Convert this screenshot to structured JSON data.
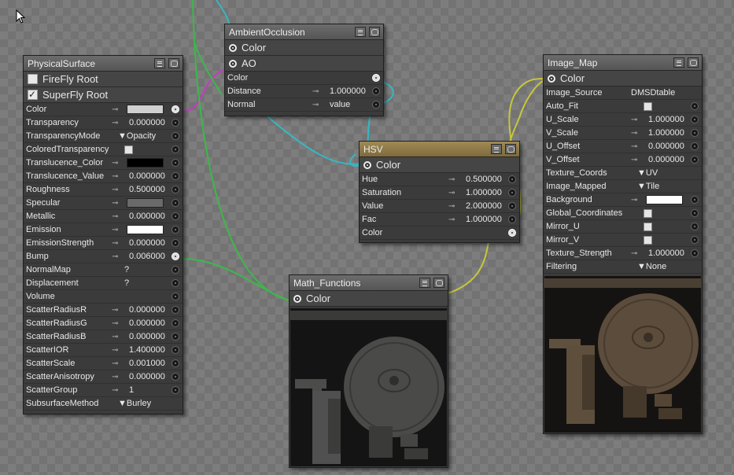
{
  "nodes": {
    "physical": {
      "title": "PhysicalSurface",
      "toggles": [
        {
          "label": "FireFly Root",
          "checked": false
        },
        {
          "label": "SuperFly Root",
          "checked": true
        }
      ],
      "rows": [
        {
          "label": "Color",
          "kind": "swatch",
          "color": "#cfcfcf",
          "out": true
        },
        {
          "label": "Transparency",
          "kind": "num",
          "value": "0.000000"
        },
        {
          "label": "TransparencyMode",
          "kind": "enum",
          "value": "▼Opacity"
        },
        {
          "label": "ColoredTransparency",
          "kind": "check"
        },
        {
          "label": "Translucence_Color",
          "kind": "swatch",
          "color": "#000000"
        },
        {
          "label": "Translucence_Value",
          "kind": "num",
          "value": "0.000000"
        },
        {
          "label": "Roughness",
          "kind": "num",
          "value": "0.500000"
        },
        {
          "label": "Specular",
          "kind": "swatch",
          "color": "#6a6a6a"
        },
        {
          "label": "Metallic",
          "kind": "num",
          "value": "0.000000"
        },
        {
          "label": "Emission",
          "kind": "swatch",
          "color": "#ffffff"
        },
        {
          "label": "EmissionStrength",
          "kind": "num",
          "value": "0.000000"
        },
        {
          "label": "Bump",
          "kind": "num",
          "value": "0.006000",
          "out": true
        },
        {
          "label": "NormalMap",
          "kind": "q",
          "value": "?"
        },
        {
          "label": "Displacement",
          "kind": "q",
          "value": "?"
        },
        {
          "label": "Volume",
          "kind": "none"
        },
        {
          "label": "ScatterRadiusR",
          "kind": "num",
          "value": "0.000000"
        },
        {
          "label": "ScatterRadiusG",
          "kind": "num",
          "value": "0.000000"
        },
        {
          "label": "ScatterRadiusB",
          "kind": "num",
          "value": "0.000000"
        },
        {
          "label": "ScatterIOR",
          "kind": "num",
          "value": "1.400000"
        },
        {
          "label": "ScatterScale",
          "kind": "num",
          "value": "0.001000"
        },
        {
          "label": "ScatterAnisotropy",
          "kind": "num",
          "value": "0.000000"
        },
        {
          "label": "ScatterGroup",
          "kind": "num",
          "value": "1"
        },
        {
          "label": "SubsurfaceMethod",
          "kind": "enum",
          "value": "▼Burley",
          "nopin": true
        }
      ]
    },
    "ao": {
      "title": "AmbientOcclusion",
      "outputs": [
        "Color",
        "AO"
      ],
      "rows": [
        {
          "label": "Color",
          "kind": "none",
          "out": true
        },
        {
          "label": "Distance",
          "kind": "num",
          "value": "1.000000"
        },
        {
          "label": "Normal",
          "kind": "num",
          "value": "value"
        }
      ]
    },
    "hsv": {
      "title": "HSV",
      "outputs": [
        "Color"
      ],
      "rows": [
        {
          "label": "Hue",
          "kind": "num",
          "value": "0.500000"
        },
        {
          "label": "Saturation",
          "kind": "num",
          "value": "1.000000"
        },
        {
          "label": "Value",
          "kind": "num",
          "value": "2.000000"
        },
        {
          "label": "Fac",
          "kind": "num",
          "value": "1.000000"
        },
        {
          "label": "Color",
          "kind": "none",
          "out": true
        }
      ]
    },
    "math": {
      "title": "Math_Functions",
      "outputs": [
        "Color"
      ]
    },
    "image": {
      "title": "Image_Map",
      "outputs": [
        "Color"
      ],
      "rows": [
        {
          "label": "Image_Source",
          "kind": "text",
          "value": "DMSDtable",
          "nopin": true
        },
        {
          "label": "Auto_Fit",
          "kind": "check"
        },
        {
          "label": "U_Scale",
          "kind": "num",
          "value": "1.000000"
        },
        {
          "label": "V_Scale",
          "kind": "num",
          "value": "1.000000"
        },
        {
          "label": "U_Offset",
          "kind": "num",
          "value": "0.000000"
        },
        {
          "label": "V_Offset",
          "kind": "num",
          "value": "0.000000"
        },
        {
          "label": "Texture_Coords",
          "kind": "enum",
          "value": "▼UV",
          "nopin": true
        },
        {
          "label": "Image_Mapped",
          "kind": "enum",
          "value": "▼Tile",
          "nopin": true
        },
        {
          "label": "Background",
          "kind": "swatch",
          "color": "#ffffff"
        },
        {
          "label": "Global_Coordinates",
          "kind": "check"
        },
        {
          "label": "Mirror_U",
          "kind": "check"
        },
        {
          "label": "Mirror_V",
          "kind": "check"
        },
        {
          "label": "Texture_Strength",
          "kind": "num",
          "value": "1.000000"
        },
        {
          "label": "Filtering",
          "kind": "enum",
          "value": "▼None",
          "nopin": true
        }
      ]
    }
  },
  "wire_colors": {
    "magenta": "#c23cc2",
    "cyan": "#35b8c4",
    "green": "#3cb84a",
    "yellow": "#c8c83a"
  },
  "icons": [
    "list-icon",
    "preview-icon",
    "output-socket-icon",
    "input-socket-icon",
    "key-icon",
    "mouse-cursor-icon"
  ]
}
